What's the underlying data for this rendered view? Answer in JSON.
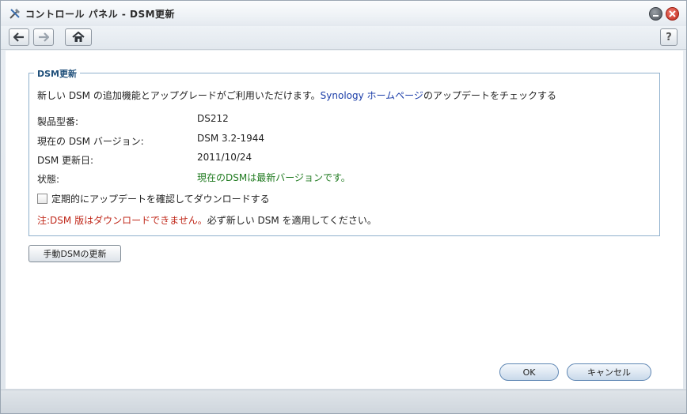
{
  "window": {
    "title": "コントロール パネル - DSM更新",
    "help_label": "?"
  },
  "section": {
    "legend": "DSM更新",
    "intro_text": "新しい DSM の追加機能とアップグレードがご利用いただけます。",
    "intro_link": "Synology ホームページ",
    "intro_suffix": "のアップデートをチェックする"
  },
  "info": {
    "rows": [
      {
        "label": "製品型番:",
        "value": "DS212"
      },
      {
        "label": "現在の DSM バージョン:",
        "value": "DSM 3.2-1944"
      },
      {
        "label": "DSM 更新日:",
        "value": "2011/10/24"
      },
      {
        "label": "状態:",
        "value": "現在のDSMは最新バージョンです。"
      }
    ]
  },
  "checkbox": {
    "label": "定期的にアップデートを確認してダウンロードする",
    "checked": false
  },
  "note": {
    "warning": "注:DSM 版はダウンロードできません。",
    "text": "必ず新しい DSM を適用してください。"
  },
  "buttons": {
    "manual_update": "手動DSMの更新",
    "ok": "OK",
    "cancel": "キャンセル"
  },
  "colors": {
    "status_ok": "#1f7a1f",
    "warning": "#c0281a",
    "link": "#1a3ca8",
    "legend": "#1f4f7a"
  }
}
